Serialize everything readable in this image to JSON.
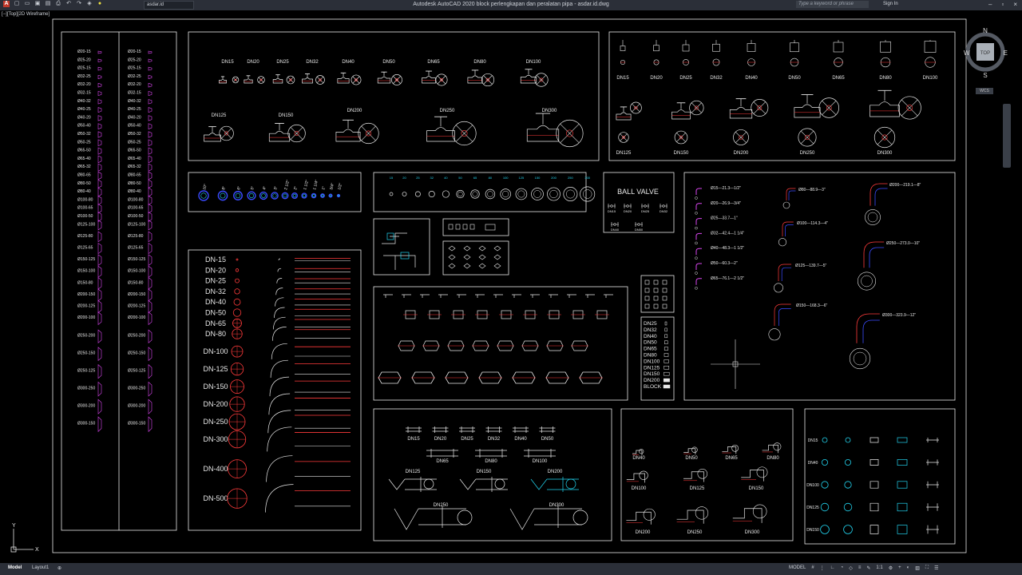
{
  "window": {
    "title": "Autodesk AutoCAD 2020   block perlengkapan dan peralatan pipa - asdar.id.dwg",
    "file_dropdown": "asdar.id",
    "search_placeholder": "Type a keyword or phrase",
    "sign_in": "Sign In"
  },
  "viewport_label": "[−][Top][2D Wireframe]",
  "viewcube": {
    "n": "N",
    "s": "S",
    "e": "E",
    "w": "W",
    "top": "TOP",
    "wcs": "WCS"
  },
  "status": {
    "tabs": [
      "Model",
      "Layout1"
    ],
    "model_label": "MODEL",
    "scale": "1:1"
  },
  "colors": {
    "frame": "#e8e8e8",
    "red": "#ff3b3b",
    "blue": "#3a4bff",
    "cyan": "#22d3ee",
    "magenta": "#d946ef",
    "yellow": "#f0e442"
  },
  "drawing": {
    "reducer_col1": [
      "Ø20-15",
      "Ø25-20",
      "Ø25-15",
      "Ø32-25",
      "Ø32-20",
      "Ø32-15",
      "Ø40-32",
      "Ø40-25",
      "Ø40-20",
      "Ø50-40",
      "Ø50-32",
      "Ø50-25",
      "Ø65-50",
      "Ø65-40",
      "Ø65-32",
      "Ø80-65",
      "Ø80-50",
      "Ø80-40",
      "Ø100-80",
      "Ø100-65",
      "Ø100-50",
      "Ø125-100",
      "Ø125-80",
      "Ø125-65",
      "Ø150-125",
      "Ø150-100",
      "Ø150-80",
      "Ø200-150",
      "Ø200-125",
      "Ø200-100",
      "Ø250-200",
      "Ø250-150",
      "Ø250-125",
      "Ø300-250",
      "Ø300-200",
      "Ø300-150"
    ],
    "valve_top_sizes": [
      "DN15",
      "DN20",
      "DN25",
      "DN32",
      "DN40",
      "DN50",
      "DN65",
      "DN80",
      "DN100"
    ],
    "valve_bottom_sizes": [
      "DN125",
      "DN150",
      "DN200",
      "DN250",
      "DN300"
    ],
    "gate_top_sizes": [
      "DN15",
      "DN20",
      "DN25",
      "DN32",
      "DN40",
      "DN50",
      "DN65",
      "DN80",
      "DN100"
    ],
    "gate_bottom_sizes": [
      "DN125",
      "DN150",
      "DN200",
      "DN250",
      "DN300"
    ],
    "pipe_circle_labels": [
      "10\"",
      "8\"",
      "6\"",
      "5\"",
      "4\"",
      "3\"",
      "2 1/2\"",
      "2\"",
      "1 1/2\"",
      "1 1/4\"",
      "1\"",
      "3/4\"",
      "1/2\""
    ],
    "flange_scale_labels": [
      "15",
      "20",
      "25",
      "32",
      "40",
      "50",
      "65",
      "80",
      "100",
      "125",
      "150",
      "200",
      "250",
      "300"
    ],
    "ball_valve_title": "BALL VALVE",
    "ball_valve_sizes": [
      "DN15",
      "DN20",
      "DN25",
      "DN32",
      "DN40",
      "DN50"
    ],
    "dn_pipe_sizes": [
      "DN-15",
      "DN-20",
      "DN-25",
      "DN-32",
      "DN-40",
      "DN-50",
      "DN-65",
      "DN-80",
      "DN-100",
      "DN-125",
      "DN-150",
      "DN-200",
      "DN-250",
      "DN-300",
      "DN-400",
      "DN-500"
    ],
    "dn_list_small": [
      "DN25",
      "DN32",
      "DN40",
      "DN50",
      "DN65",
      "DN80",
      "DN100",
      "DN125",
      "DN150",
      "DN200",
      "BLOCK"
    ],
    "elbow_col1": [
      "Ø15—21.3—1/2\"",
      "Ø20—26.9—3/4\"",
      "Ø25—33.7—1\"",
      "Ø32—42.4—1 1/4\"",
      "Ø40—48.3—1 1/2\"",
      "Ø50—60.3—2\"",
      "Ø65—76.1—2 1/2\""
    ],
    "elbow_col2": [
      "Ø80—88.9—3\"",
      "Ø100—114.3—4\"",
      "Ø125—139.7—5\"",
      "Ø150—168.3—6\""
    ],
    "elbow_col3": [
      "Ø200—219.1—8\"",
      "Ø250—273.0—10\"",
      "Ø300—323.9—12\""
    ],
    "check_top_sizes": [
      "DN15",
      "DN20",
      "DN25",
      "DN32",
      "DN40",
      "DN50"
    ],
    "check_mid_sizes": [
      "DN65",
      "DN80",
      "DN100"
    ],
    "check_bottom_sizes": [
      "DN125",
      "DN150",
      "DN200"
    ],
    "check_large_sizes": [
      "DN250",
      "DN300"
    ],
    "angle_valve_sizes": [
      "DN40",
      "DN50",
      "DN65",
      "DN80",
      "DN100",
      "DN125",
      "DN150",
      "DN200",
      "DN250",
      "DN300"
    ],
    "bottom_right_sizes": [
      "DN15",
      "DN40",
      "DN100",
      "DN125",
      "DN150"
    ],
    "ucs": {
      "x": "X",
      "y": "Y"
    }
  }
}
